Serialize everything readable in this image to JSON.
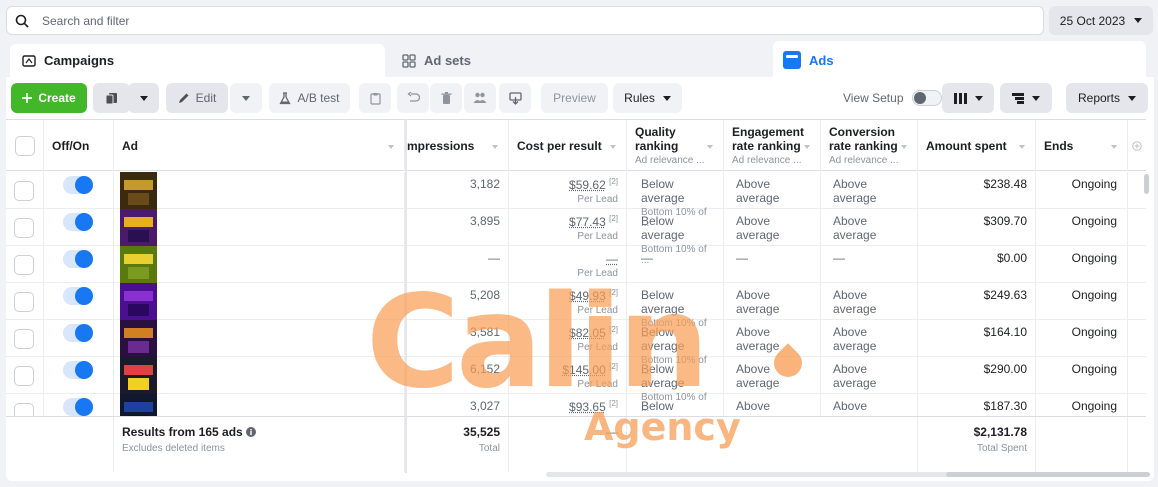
{
  "search": {
    "placeholder": "Search and filter"
  },
  "date_range": {
    "label": "25 Oct 2023"
  },
  "tabs": [
    {
      "label": "Campaigns"
    },
    {
      "label": "Ad sets"
    },
    {
      "label": "Ads"
    }
  ],
  "toolbar": {
    "create": "Create",
    "edit": "Edit",
    "ab_test": "A/B test",
    "preview": "Preview",
    "rules": "Rules",
    "view_setup": "View Setup",
    "reports": "Reports"
  },
  "columns": {
    "off_on": "Off/On",
    "ad": "Ad",
    "impressions": "mpressions",
    "cost_per_result": "Cost per result",
    "quality": {
      "title1": "Quality",
      "title2": "ranking",
      "sub": "Ad relevance ..."
    },
    "engagement": {
      "title1": "Engagement",
      "title2": "rate ranking",
      "sub": "Ad relevance ..."
    },
    "conversion": {
      "title1": "Conversion",
      "title2": "rate ranking",
      "sub": "Ad relevance ..."
    },
    "amount_spent": "Amount spent",
    "ends": "Ends"
  },
  "rows": [
    {
      "impressions": "3,182",
      "cost": "$59.62",
      "cost_note": "[2]",
      "cost_sub": "Per Lead",
      "quality": "Below average",
      "quality_sub": "Bottom 10% of ...",
      "engagement": "Above average",
      "conversion": "Above average",
      "spent": "$238.48",
      "ends": "Ongoing"
    },
    {
      "impressions": "3,895",
      "cost": "$77.43",
      "cost_note": "[2]",
      "cost_sub": "Per Lead",
      "quality": "Below average",
      "quality_sub": "Bottom 10% of ...",
      "engagement": "Above average",
      "conversion": "Above average",
      "spent": "$309.70",
      "ends": "Ongoing"
    },
    {
      "impressions": "—",
      "cost": "—",
      "cost_note": "",
      "cost_sub": "Per Lead",
      "quality": "—",
      "quality_sub": "",
      "engagement": "—",
      "conversion": "—",
      "spent": "$0.00",
      "ends": "Ongoing"
    },
    {
      "impressions": "5,208",
      "cost": "$49.93",
      "cost_note": "[2]",
      "cost_sub": "Per Lead",
      "quality": "Below average",
      "quality_sub": "Bottom 10% of ...",
      "engagement": "Above average",
      "conversion": "Above average",
      "spent": "$249.63",
      "ends": "Ongoing"
    },
    {
      "impressions": "3,581",
      "cost": "$82.05",
      "cost_note": "[2]",
      "cost_sub": "Per Lead",
      "quality": "Below average",
      "quality_sub": "Bottom 10% of ...",
      "engagement": "Above average",
      "conversion": "Above average",
      "spent": "$164.10",
      "ends": "Ongoing"
    },
    {
      "impressions": "6,152",
      "cost": "$145.00",
      "cost_note": "[2]",
      "cost_sub": "Per Lead",
      "quality": "Below average",
      "quality_sub": "Bottom 10% of ...",
      "engagement": "Above average",
      "conversion": "Above average",
      "spent": "$290.00",
      "ends": "Ongoing"
    },
    {
      "impressions": "3,027",
      "cost": "$93.65",
      "cost_note": "[2]",
      "cost_sub": "",
      "quality": "Below average",
      "quality_sub": "",
      "engagement": "Above average",
      "conversion": "Above average",
      "spent": "$187.30",
      "ends": "Ongoing"
    }
  ],
  "totals": {
    "label": "Results from 165 ads",
    "sub": "Excludes deleted items",
    "impressions": "35,525",
    "impressions_sub": "Total",
    "cost": "—",
    "spent": "$2,131.78",
    "spent_sub": "Total Spent"
  },
  "watermark": {
    "main": "Calin",
    "sub": "Agency"
  },
  "colors": {
    "accent": "#1877f2",
    "create": "#42b72a",
    "watermark": "#f89e56"
  },
  "thumb_colors": [
    [
      "#3a2a10",
      "#c49a2c",
      "#6b4a1a"
    ],
    [
      "#4a1a6b",
      "#e8b020",
      "#2a1050"
    ],
    [
      "#5a7a10",
      "#e8d030",
      "#7a9a20"
    ],
    [
      "#4a1090",
      "#8a30d0",
      "#2a0860"
    ],
    [
      "#2a1040",
      "#d08020",
      "#6a2a90"
    ],
    [
      "#1a1a2a",
      "#e04040",
      "#f0d020"
    ],
    [
      "#101830",
      "#2040a0",
      "#101020"
    ]
  ]
}
